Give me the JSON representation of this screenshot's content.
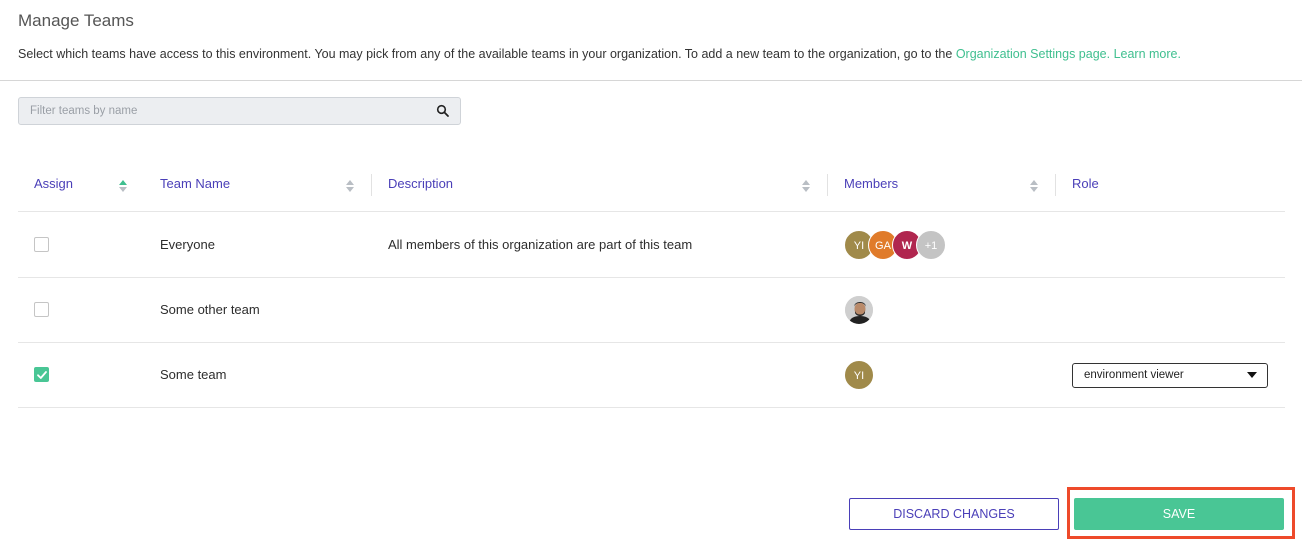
{
  "page": {
    "title": "Manage Teams",
    "intro_text": "Select which teams have access to this environment. You may pick from any of the available teams in your organization. To add a new team to the organization, go to the ",
    "settings_link": "Organization Settings page.",
    "learn_more_link": "Learn more."
  },
  "search": {
    "placeholder": "Filter teams by name",
    "value": ""
  },
  "table": {
    "columns": {
      "assign": "Assign",
      "team_name": "Team Name",
      "description": "Description",
      "members": "Members",
      "role": "Role"
    },
    "rows": [
      {
        "checked": false,
        "team_name": "Everyone",
        "description": "All members of this organization are part of this team",
        "members": [
          {
            "initials": "YI",
            "color": "#a08a4a"
          },
          {
            "initials": "GA",
            "color": "#e07b2a"
          },
          {
            "initials": "W",
            "color": "#b0264f"
          },
          {
            "initials": "+1",
            "color": "#c4c4c4"
          }
        ],
        "role": ""
      },
      {
        "checked": false,
        "team_name": "Some other team",
        "description": "",
        "members": [
          {
            "initials": "",
            "color": "#3a3a3a",
            "photo": true
          }
        ],
        "role": ""
      },
      {
        "checked": true,
        "team_name": "Some team",
        "description": "",
        "members": [
          {
            "initials": "YI",
            "color": "#a08a4a"
          }
        ],
        "role": "environment viewer"
      }
    ]
  },
  "actions": {
    "discard_label": "DISCARD CHANGES",
    "save_label": "SAVE"
  },
  "colors": {
    "accent_green": "#49c695",
    "link_green": "#3fbf8f",
    "header_purple": "#4a3fb8",
    "highlight_red": "#ee4a2a"
  }
}
